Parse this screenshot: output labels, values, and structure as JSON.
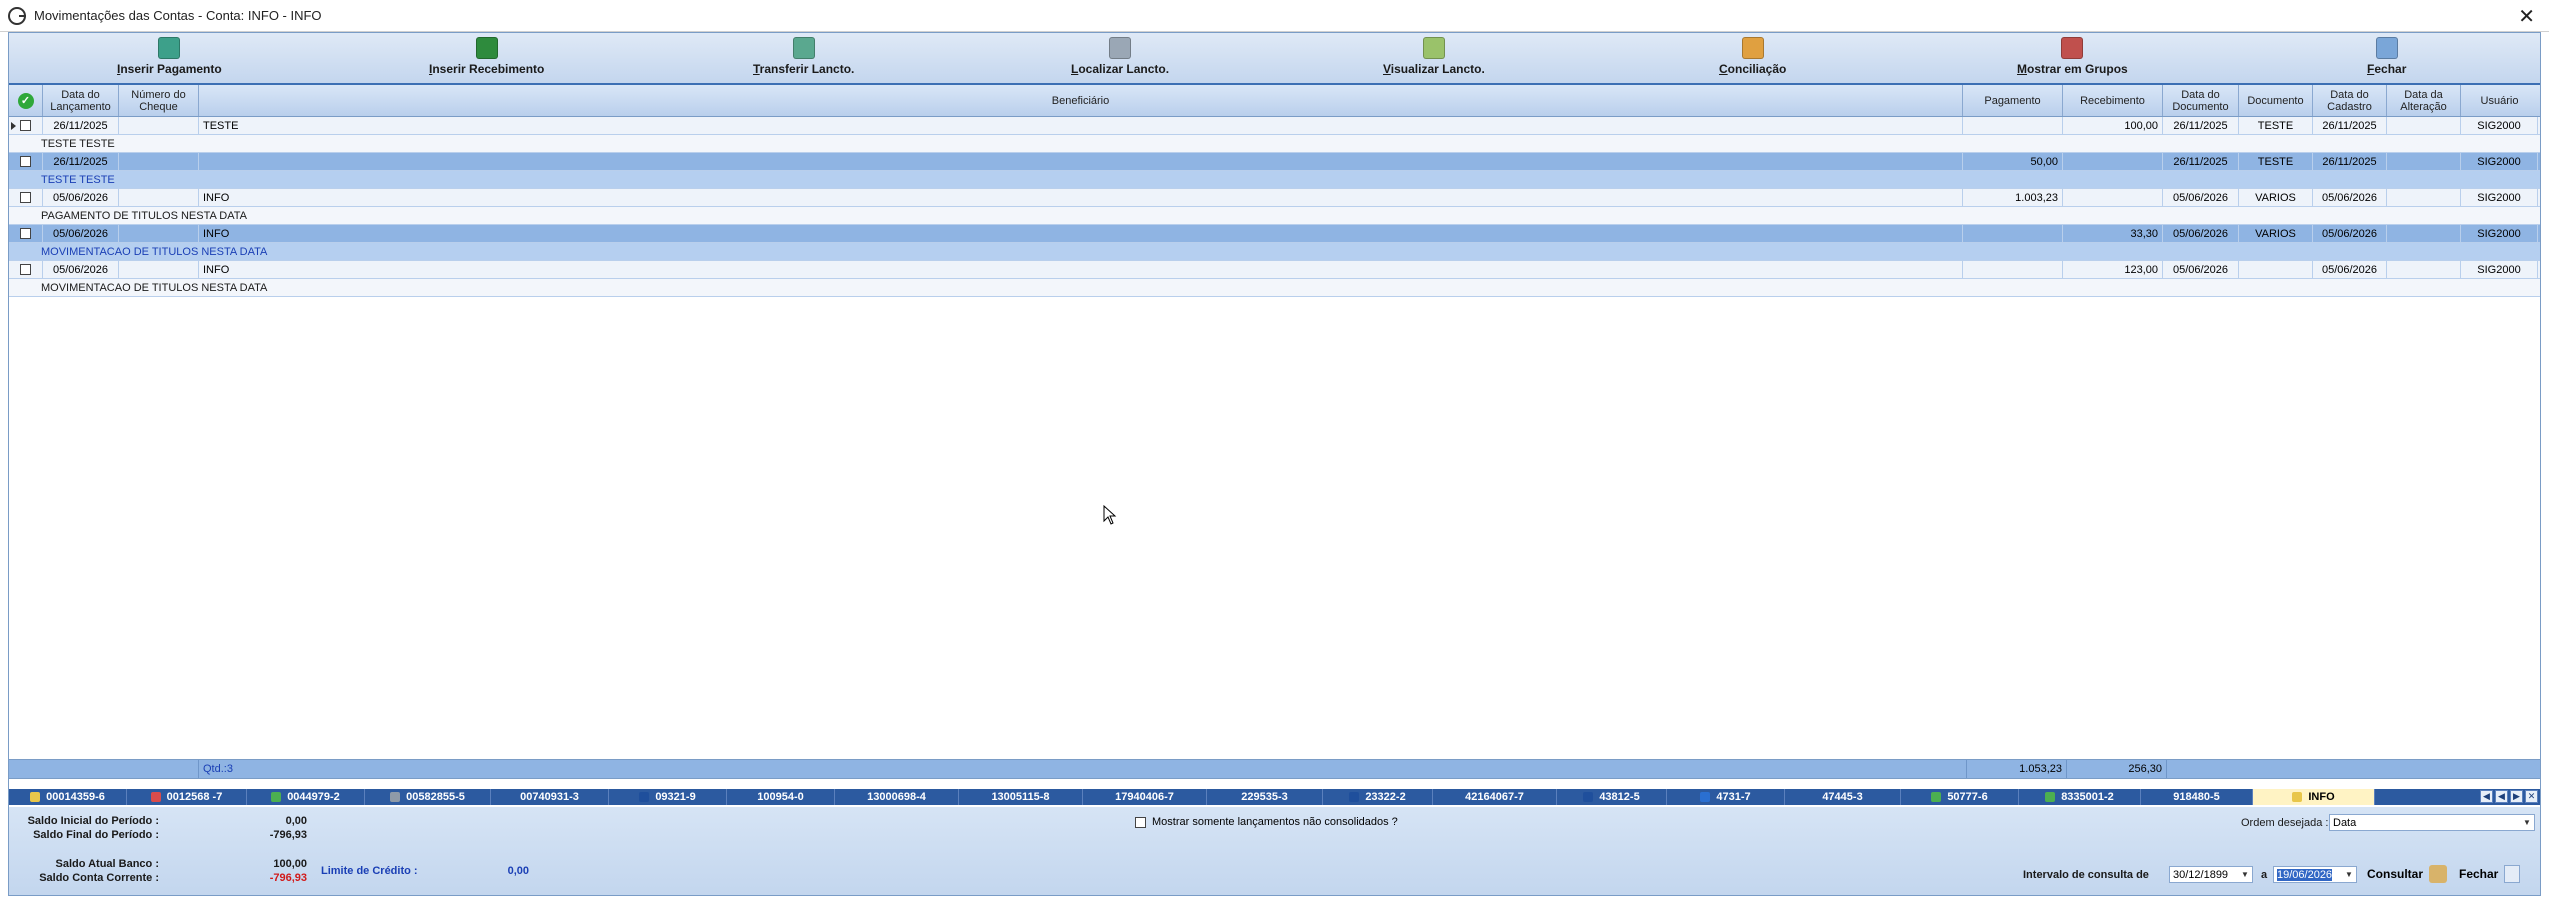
{
  "window": {
    "title": "Movimentações das Contas - Conta: INFO - INFO"
  },
  "toolbar": {
    "buttons": [
      {
        "label": "Inserir Pagamento",
        "icon": "insert-payment-icon",
        "color": "#3da08a"
      },
      {
        "label": "Inserir Recebimento",
        "icon": "insert-receipt-icon",
        "color": "#2e8b3d"
      },
      {
        "label": "Transferir Lancto.",
        "icon": "transfer-icon",
        "color": "#5aa88f"
      },
      {
        "label": "Localizar Lancto.",
        "icon": "search-icon",
        "color": "#9aa7b5"
      },
      {
        "label": "Visualizar Lancto.",
        "icon": "view-icon",
        "color": "#9ac26a"
      },
      {
        "label": "Conciliação",
        "icon": "reconcile-icon",
        "color": "#e0a040"
      },
      {
        "label": "Mostrar em Grupos",
        "icon": "groups-icon",
        "color": "#c0504d"
      },
      {
        "label": "Fechar",
        "icon": "exit-icon",
        "color": "#7aa6d8"
      }
    ]
  },
  "grid": {
    "columns": {
      "data_lancamento": "Data do Lançamento",
      "numero_cheque": "Número do Cheque",
      "beneficiario": "Beneficiário",
      "pagamento": "Pagamento",
      "recebimento": "Recebimento",
      "data_documento": "Data do Documento",
      "documento": "Documento",
      "data_cadastro": "Data do Cadastro",
      "data_alteracao": "Data da Alteração",
      "usuario": "Usuário"
    },
    "rows": [
      {
        "data_lancamento": "26/11/2025",
        "numero_cheque": "",
        "beneficiario": "TESTE",
        "pagamento": "",
        "recebimento": "100,00",
        "data_documento": "26/11/2025",
        "documento": "TESTE",
        "data_cadastro": "26/11/2025",
        "data_alteracao": "",
        "usuario": "SIG2000",
        "detail": "TESTE TESTE"
      },
      {
        "data_lancamento": "26/11/2025",
        "numero_cheque": "",
        "beneficiario": "",
        "pagamento": "50,00",
        "recebimento": "",
        "data_documento": "26/11/2025",
        "documento": "TESTE",
        "data_cadastro": "26/11/2025",
        "data_alteracao": "",
        "usuario": "SIG2000",
        "detail": "TESTE TESTE"
      },
      {
        "data_lancamento": "05/06/2026",
        "numero_cheque": "",
        "beneficiario": "INFO",
        "pagamento": "1.003,23",
        "recebimento": "",
        "data_documento": "05/06/2026",
        "documento": "VARIOS",
        "data_cadastro": "05/06/2026",
        "data_alteracao": "",
        "usuario": "SIG2000",
        "detail": "PAGAMENTO DE TITULOS NESTA DATA"
      },
      {
        "data_lancamento": "05/06/2026",
        "numero_cheque": "",
        "beneficiario": "INFO",
        "pagamento": "",
        "recebimento": "33,30",
        "data_documento": "05/06/2026",
        "documento": "VARIOS",
        "data_cadastro": "05/06/2026",
        "data_alteracao": "",
        "usuario": "SIG2000",
        "detail": "MOVIMENTACAO DE TITULOS NESTA DATA"
      },
      {
        "data_lancamento": "05/06/2026",
        "numero_cheque": "",
        "beneficiario": "INFO",
        "pagamento": "",
        "recebimento": "123,00",
        "data_documento": "05/06/2026",
        "documento": "",
        "data_cadastro": "05/06/2026",
        "data_alteracao": "",
        "usuario": "SIG2000",
        "detail": "MOVIMENTACAO DE TITULOS NESTA DATA"
      }
    ],
    "totals": {
      "qtd": "Qtd.:3",
      "pagamento": "1.053,23",
      "recebimento": "256,30"
    }
  },
  "account_tabs": [
    {
      "label": "00014359-6",
      "icon": "bank-logo-icon",
      "color": "#e8c64a"
    },
    {
      "label": "0012568 -7",
      "icon": "bank-logo-icon",
      "color": "#d94c4c"
    },
    {
      "label": "0044979-2",
      "icon": "bank-logo-icon",
      "color": "#4caf50"
    },
    {
      "label": "00582855-5",
      "icon": "bank-logo-icon",
      "color": "#8e9aa8"
    },
    {
      "label": "00740931-3",
      "icon": "",
      "color": ""
    },
    {
      "label": "09321-9",
      "icon": "bank-logo-icon",
      "color": "#1f4f9c"
    },
    {
      "label": "100954-0",
      "icon": "",
      "color": ""
    },
    {
      "label": "13000698-4",
      "icon": "",
      "color": ""
    },
    {
      "label": "13005115-8",
      "icon": "",
      "color": ""
    },
    {
      "label": "17940406-7",
      "icon": "",
      "color": ""
    },
    {
      "label": "229535-3",
      "icon": "",
      "color": ""
    },
    {
      "label": "23322-2",
      "icon": "bank-logo-icon",
      "color": "#1f4f9c"
    },
    {
      "label": "42164067-7",
      "icon": "",
      "color": ""
    },
    {
      "label": "43812-5",
      "icon": "bank-logo-icon",
      "color": "#1f4f9c"
    },
    {
      "label": "4731-7",
      "icon": "bank-logo-icon",
      "color": "#2a6fd1"
    },
    {
      "label": "47445-3",
      "icon": "",
      "color": ""
    },
    {
      "label": "50777-6",
      "icon": "bank-logo-icon",
      "color": "#4caf50"
    },
    {
      "label": "8335001-2",
      "icon": "bank-logo-icon",
      "color": "#4caf50"
    },
    {
      "label": "918480-5",
      "icon": "",
      "color": ""
    },
    {
      "label": "INFO",
      "icon": "bank-logo-icon",
      "color": "#e8c64a",
      "active": true
    }
  ],
  "footer": {
    "saldo_inicial_label": "Saldo Inicial do Período :",
    "saldo_inicial_value": "0,00",
    "saldo_final_label": "Saldo Final do Período :",
    "saldo_final_value": "-796,93",
    "saldo_banco_label": "Saldo Atual Banco :",
    "saldo_banco_value": "100,00",
    "saldo_cc_label": "Saldo Conta Corrente :",
    "saldo_cc_value": "-796,93",
    "limite_label": "Limite de Crédito :",
    "limite_value": "0,00",
    "consolidados_label": "Mostrar somente lançamentos não consolidados ?",
    "ordem_label": "Ordem desejada :",
    "ordem_value": "Data",
    "intervalo_label": "Intervalo de consulta de",
    "data_de": "30/12/1899",
    "a_label": "a",
    "data_ate": "19/06/2026",
    "consultar_label": "Consultar",
    "fechar_label": "Fechar"
  }
}
